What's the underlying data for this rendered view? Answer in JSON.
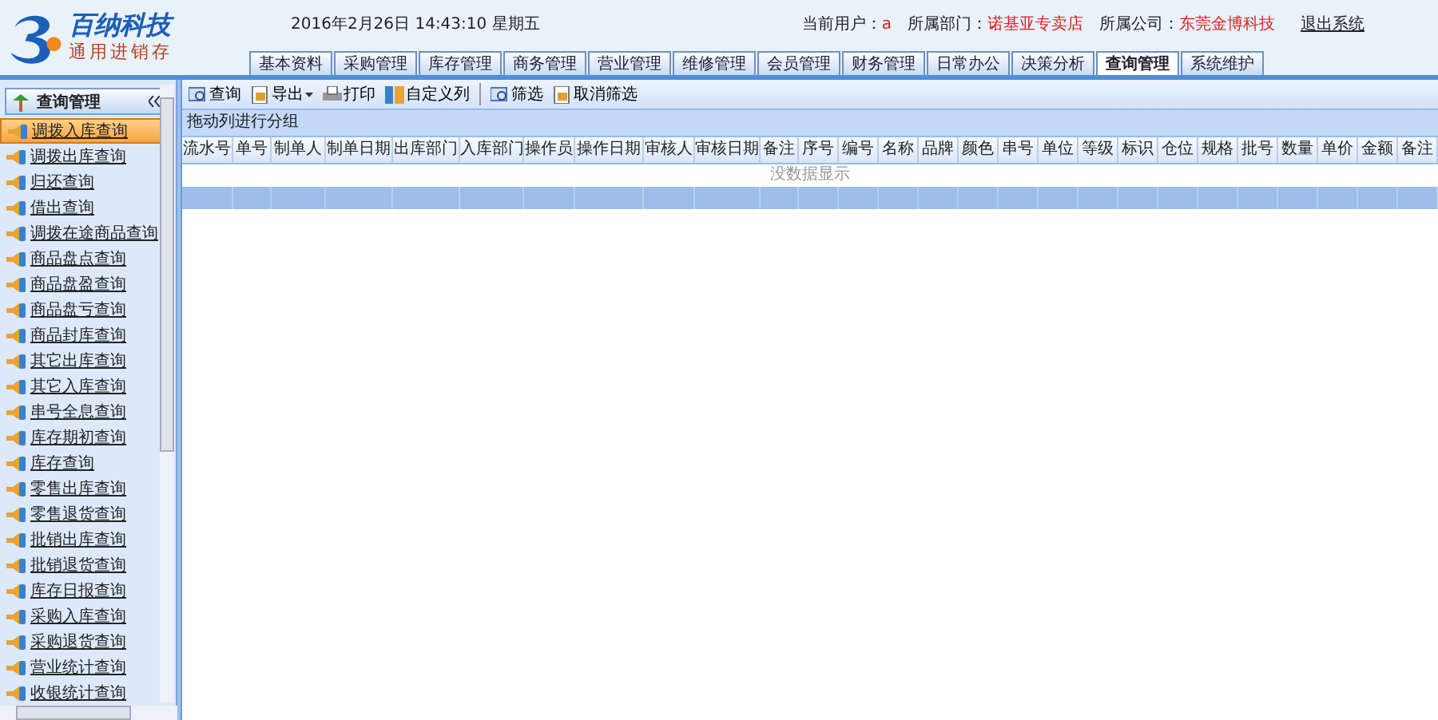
{
  "logo": {
    "title": "百纳科技",
    "subtitle": "通用进销存"
  },
  "datetime": "2016年2月26日 14:43:10 星期五",
  "user_info": [
    {
      "label": "当前用户：",
      "value": "a"
    },
    {
      "label": "所属部门：",
      "value": "诺基亚专卖店"
    },
    {
      "label": "所属公司：",
      "value": "东莞金博科技"
    }
  ],
  "logout": "退出系统",
  "tabs": [
    {
      "label": "基本资料",
      "selected": false
    },
    {
      "label": "采购管理",
      "selected": false
    },
    {
      "label": "库存管理",
      "selected": false
    },
    {
      "label": "商务管理",
      "selected": false
    },
    {
      "label": "营业管理",
      "selected": false
    },
    {
      "label": "维修管理",
      "selected": false
    },
    {
      "label": "会员管理",
      "selected": false
    },
    {
      "label": "财务管理",
      "selected": false
    },
    {
      "label": "日常办公",
      "selected": false
    },
    {
      "label": "决策分析",
      "selected": false
    },
    {
      "label": "查询管理",
      "selected": true
    },
    {
      "label": "系统维护",
      "selected": false
    }
  ],
  "sidebar": {
    "title": "查询管理",
    "items": [
      {
        "label": "调拨入库查询",
        "selected": true
      },
      {
        "label": "调拨出库查询",
        "selected": false
      },
      {
        "label": "归还查询",
        "selected": false
      },
      {
        "label": "借出查询",
        "selected": false
      },
      {
        "label": "调拨在途商品查询",
        "selected": false
      },
      {
        "label": "商品盘点查询",
        "selected": false
      },
      {
        "label": "商品盘盈查询",
        "selected": false
      },
      {
        "label": "商品盘亏查询",
        "selected": false
      },
      {
        "label": "商品封库查询",
        "selected": false
      },
      {
        "label": "其它出库查询",
        "selected": false
      },
      {
        "label": "其它入库查询",
        "selected": false
      },
      {
        "label": "串号全息查询",
        "selected": false
      },
      {
        "label": "库存期初查询",
        "selected": false
      },
      {
        "label": "库存查询",
        "selected": false
      },
      {
        "label": "零售出库查询",
        "selected": false
      },
      {
        "label": "零售退货查询",
        "selected": false
      },
      {
        "label": "批销出库查询",
        "selected": false
      },
      {
        "label": "批销退货查询",
        "selected": false
      },
      {
        "label": "库存日报查询",
        "selected": false
      },
      {
        "label": "采购入库查询",
        "selected": false
      },
      {
        "label": "采购退货查询",
        "selected": false
      },
      {
        "label": "营业统计查询",
        "selected": false
      },
      {
        "label": "收银统计查询",
        "selected": false
      }
    ]
  },
  "toolbar": [
    {
      "label": "查询",
      "dropdown": false,
      "separator_before": false
    },
    {
      "label": "导出",
      "dropdown": true,
      "separator_before": false
    },
    {
      "label": "打印",
      "dropdown": false,
      "separator_before": false
    },
    {
      "label": "自定义列",
      "dropdown": false,
      "separator_before": false
    },
    {
      "label": "筛选",
      "dropdown": false,
      "separator_before": true
    },
    {
      "label": "取消筛选",
      "dropdown": false,
      "separator_before": false
    }
  ],
  "group_bar": "拖动列进行分组",
  "table": {
    "columns": [
      "流水号",
      "单号",
      "制单人",
      "制单日期",
      "出库部门",
      "入库部门",
      "操作员",
      "操作日期",
      "审核人",
      "审核日期",
      "备注",
      "序号",
      "编号",
      "名称",
      "品牌",
      "颜色",
      "串号",
      "单位",
      "等级",
      "标识",
      "仓位",
      "规格",
      "批号",
      "数量",
      "单价",
      "金额",
      "备注"
    ],
    "empty_text": "没数据显示"
  }
}
